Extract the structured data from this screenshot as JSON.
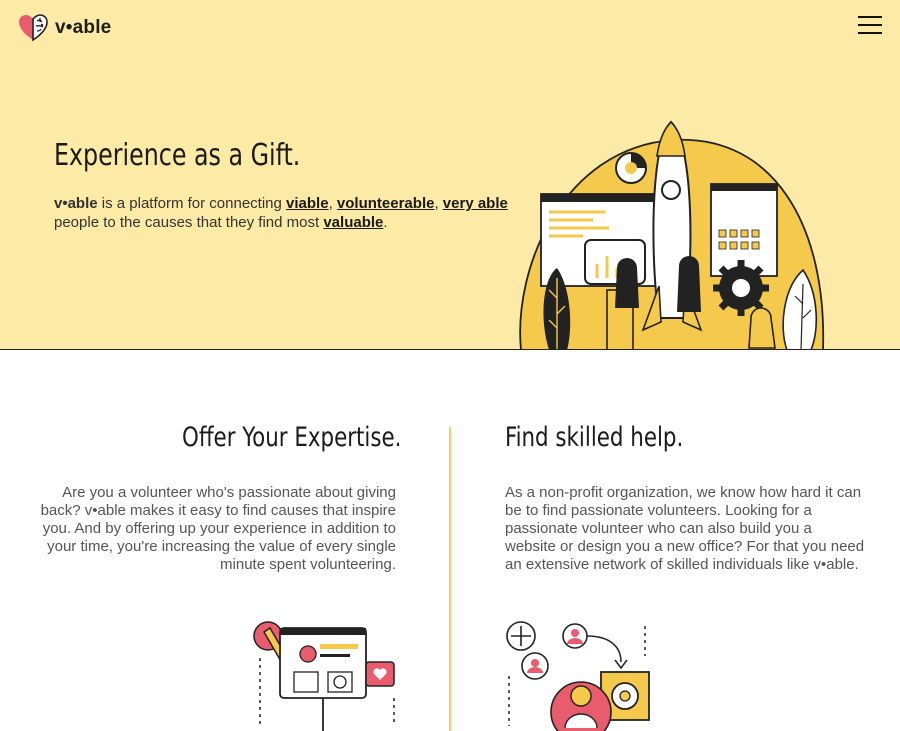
{
  "header": {
    "logo_text": "v•able",
    "logo_icon": "heart-brain-icon",
    "menu_icon": "hamburger-menu-icon"
  },
  "hero": {
    "title": "Experience as a Gift.",
    "intro_1": "v•able",
    "intro_2": " is a platform for connecting ",
    "link_viable": "viable",
    "sep_1": ", ",
    "link_volunteerable": "volunteerable",
    "sep_2": ", ",
    "link_very_able": "very able",
    "intro_3": " people to the causes that they find most ",
    "link_valuable": "valuable",
    "intro_end": "."
  },
  "offer": {
    "title": "Offer Your Expertise.",
    "text": "Are you a volunteer who's passionate about giving back? v•able makes it easy to find causes that inspire you. And by offering up your experience in addition to your time, you're increasing the value of every single minute spent volunteering."
  },
  "find": {
    "title": "Find skilled help.",
    "text": "As a non-profit organization, we know how hard it can be to find passionate volunteers. Looking for a passionate volunteer who can also build you a website or design you a new office? For that you need an extensive network of skilled individuals like v•able."
  },
  "colors": {
    "hero_bg": "#fdeaa6",
    "accent_yellow": "#f5c94b",
    "accent_pink": "#e85c6e",
    "divider": "#f2cd66"
  }
}
